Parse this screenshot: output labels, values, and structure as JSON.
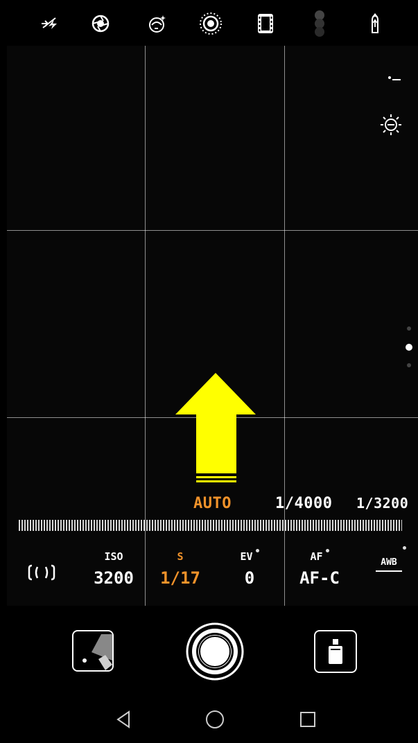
{
  "top_toolbar": {
    "icons": [
      "flash-off-icon",
      "aperture-icon",
      "beauty-face-icon",
      "live-photo-icon",
      "film-mode-icon",
      "color-mode-icon",
      "settings-swipe-icon"
    ]
  },
  "viewfinder": {
    "right_icons": [
      "exposure-comp-icon",
      "brightness-icon"
    ],
    "page_dots": 3,
    "active_dot": 1
  },
  "shutter_speeds": {
    "current": "AUTO",
    "next": "1/4000",
    "next2": "1/3200"
  },
  "settings": {
    "metering_icon": "metering-icon",
    "iso": {
      "label": "ISO",
      "value": "3200"
    },
    "shutter": {
      "label": "S",
      "value": "1/17"
    },
    "ev": {
      "label": "EV",
      "value": "0"
    },
    "af": {
      "label": "AF",
      "value": "AF-C"
    },
    "wb": {
      "label": "AWB"
    }
  },
  "colors": {
    "accent": "#f0922a",
    "arrow": "#ffff00"
  },
  "bottom": {
    "gallery": "gallery-thumbnail",
    "shutter": "shutter-button",
    "mode": "camera-mode-icon"
  },
  "navbar": [
    "back-icon",
    "home-icon",
    "recents-icon"
  ]
}
